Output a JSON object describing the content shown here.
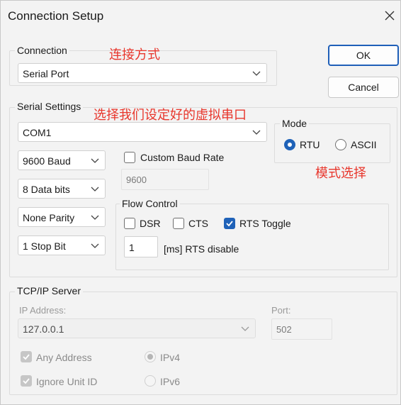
{
  "window": {
    "title": "Connection Setup"
  },
  "buttons": {
    "ok": "OK",
    "cancel": "Cancel"
  },
  "connection": {
    "label": "Connection",
    "annotation": "连接方式",
    "type": "Serial Port"
  },
  "serial": {
    "label": "Serial Settings",
    "annotation": "选择我们设定好的虚拟串口",
    "port": "COM1",
    "baud": "9600 Baud",
    "data_bits": "8 Data bits",
    "parity": "None Parity",
    "stop_bits": "1 Stop Bit",
    "custom_baud_label": "Custom Baud Rate",
    "custom_baud_value": "9600",
    "mode": {
      "label": "Mode",
      "annotation": "模式选择",
      "rtu": "RTU",
      "ascii": "ASCII",
      "selected": "RTU"
    },
    "flow": {
      "label": "Flow Control",
      "dsr": "DSR",
      "cts": "CTS",
      "rts_toggle": "RTS Toggle",
      "rts_value": "1",
      "rts_suffix": "[ms] RTS disable"
    }
  },
  "tcp": {
    "label": "TCP/IP Server",
    "ip_label": "IP Address:",
    "ip_value": "127.0.0.1",
    "port_label": "Port:",
    "port_value": "502",
    "any_address": "Any Address",
    "ignore_unit_id": "Ignore Unit ID",
    "ipv4": "IPv4",
    "ipv6": "IPv6"
  },
  "colors": {
    "accent": "#1f62b8",
    "annotation": "#e8362c"
  }
}
